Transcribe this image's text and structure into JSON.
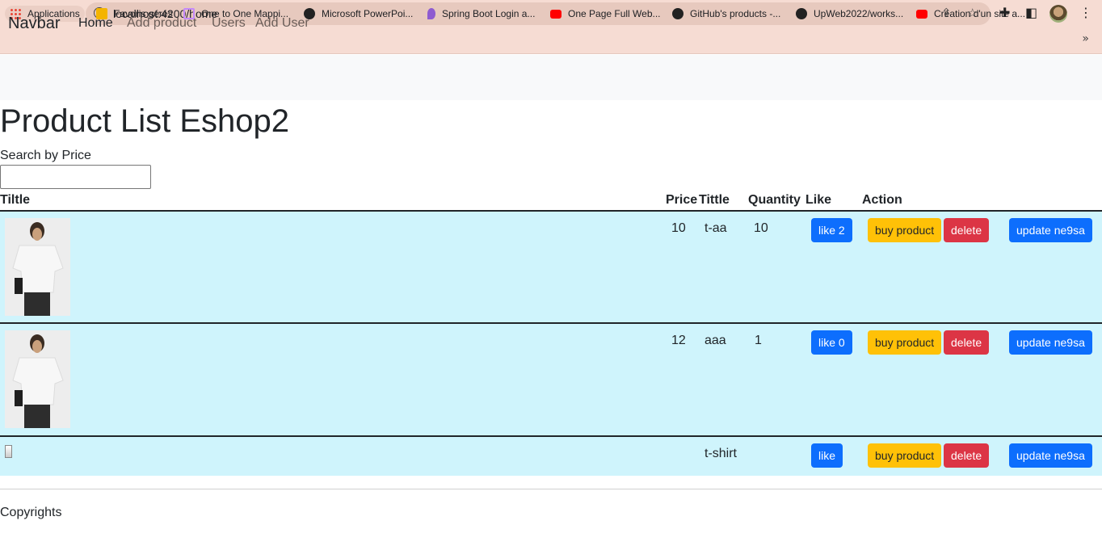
{
  "browser": {
    "url": "localhost:4200/home",
    "bookmarks": [
      {
        "label": "Applications",
        "icon": "apps-grid-icon"
      },
      {
        "label": "Favoris gérés",
        "icon": "folder-icon",
        "color": "#f4b400"
      },
      {
        "label": "One to One Mappi...",
        "icon": "bookmark-page-icon",
        "color": "#c58af9"
      },
      {
        "label": "Microsoft PowerPoi...",
        "icon": "globe-icon",
        "color": "#222222"
      },
      {
        "label": "Spring Boot Login a...",
        "icon": "drop-icon",
        "color": "#8e5bd0"
      },
      {
        "label": "One Page Full Web...",
        "icon": "youtube-icon",
        "color": "#ff0000"
      },
      {
        "label": "GitHub's products -...",
        "icon": "github-icon",
        "color": "#222222"
      },
      {
        "label": "UpWeb2022/works...",
        "icon": "github-icon",
        "color": "#222222"
      },
      {
        "label": "Création d'un site a...",
        "icon": "youtube-icon",
        "color": "#ff0000"
      }
    ]
  },
  "navbar": {
    "brand": "Navbar",
    "links": [
      "Home",
      "Add product",
      "Users",
      "Add User"
    ]
  },
  "page": {
    "title": "Product List Eshop2",
    "search_label": "Search by Price",
    "search_value": ""
  },
  "table": {
    "headers": [
      "Tiltle",
      "Price",
      "Tittle",
      "Quantity",
      "Like",
      "Action"
    ],
    "rows": [
      {
        "price": "10",
        "title": "t-aa",
        "quantity": "10",
        "like_label": "like 2",
        "buy_label": "buy product",
        "delete_label": "delete",
        "update_label": "update ne9sa"
      },
      {
        "price": "12",
        "title": "aaa",
        "quantity": "1",
        "like_label": "like 0",
        "buy_label": "buy product",
        "delete_label": "delete",
        "update_label": "update ne9sa"
      },
      {
        "price": "",
        "title": "t-shirt",
        "quantity": "",
        "like_label": "like",
        "buy_label": "buy product",
        "delete_label": "delete",
        "update_label": "update ne9sa"
      }
    ]
  },
  "footer": {
    "text": "Copyrights"
  },
  "colors": {
    "row_bg": "#cff4fc",
    "primary": "#0d6efd",
    "warning": "#ffc107",
    "danger": "#dc3545"
  }
}
